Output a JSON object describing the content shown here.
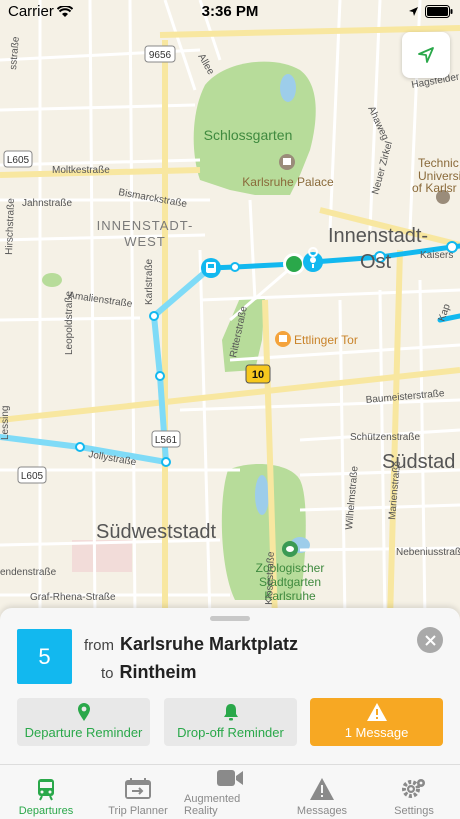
{
  "status_bar": {
    "carrier": "Carrier",
    "time": "3:36 PM"
  },
  "map": {
    "labels": {
      "schlossgarten": "Schlossgarten",
      "palace": "Karlsruhe Palace",
      "innenstadt_west": [
        "INNENSTADT-",
        "WEST"
      ],
      "innenstadt_ost": [
        "Innenstadt-",
        "Ost"
      ],
      "suedstadt": "Südstad",
      "suedweststadt": "Südweststadt",
      "zoo": [
        "Zoologischer",
        "Stadtgarten",
        "Karlsruhe"
      ],
      "ettlinger_tor": "Ettlinger Tor",
      "technical_univ": [
        "Technic",
        "Universi",
        "of Karlsr"
      ],
      "moltkestrasse": "Moltkestraße",
      "jahnstrasse": "Jahnstraße",
      "bismarckstrasse": "Bismarckstraße",
      "amalienstrasse": "Amalienstraße",
      "karlstrasse": "Karlstraße",
      "leopoldstrasse": "Leopoldstraße",
      "ritterstrasse": "Ritterstraße",
      "baumeisterstrasse": "Baumeisterstraße",
      "schuetzenstrasse": "Schützenstraße",
      "wilhelmstrasse": "Wilhelmstraße",
      "marienstrasse": "Marienstraße",
      "nebeniusstrasse": "Nebeniusstraße",
      "jollystrasse": "Jollystraße",
      "klosestrasse": "Klosestraße",
      "graf_rhena": "Graf-Rhena-Straße",
      "endenstrasse": "endenstraße",
      "hirschstrasse": "Hirschstraße",
      "hagsfelder": "Hagsfelder",
      "neuer_zirkel": "Neuer Zirkel",
      "ahaweg": "Ahaweg",
      "lessing": "Lessing",
      "kaiserstr": "Kaisers",
      "kap": "Kap",
      "allee": "Allee",
      "sstrasse": "sstraße",
      "ring_9656": "9656",
      "ring_l605_top": "L605",
      "ring_l605_bottom": "L605",
      "ring_l561": "L561",
      "ring_10": "10"
    }
  },
  "sheet": {
    "line_number": "5",
    "from_label": "from",
    "from_stop": "Karlsruhe Marktplatz",
    "to_label": "to",
    "to_stop": "Rintheim",
    "actions": [
      {
        "label": "Departure Reminder",
        "icon": "map-pin-icon"
      },
      {
        "label": "Drop-off Reminder",
        "icon": "bell-icon"
      },
      {
        "label": "1 Message",
        "icon": "warning-icon"
      }
    ]
  },
  "tabbar": {
    "tabs": [
      {
        "label": "Departures",
        "icon": "tram-icon",
        "active": true
      },
      {
        "label": "Trip Planner",
        "icon": "trip-planner-icon",
        "active": false
      },
      {
        "label": "Augmented Reality",
        "icon": "video-camera-icon",
        "active": false
      },
      {
        "label": "Messages",
        "icon": "warning-icon",
        "active": false
      },
      {
        "label": "Settings",
        "icon": "gear-icon",
        "active": false
      }
    ]
  },
  "colors": {
    "accent_green": "#2aa84a",
    "line_blue": "#12b8ef",
    "warning_orange": "#f7a823"
  }
}
